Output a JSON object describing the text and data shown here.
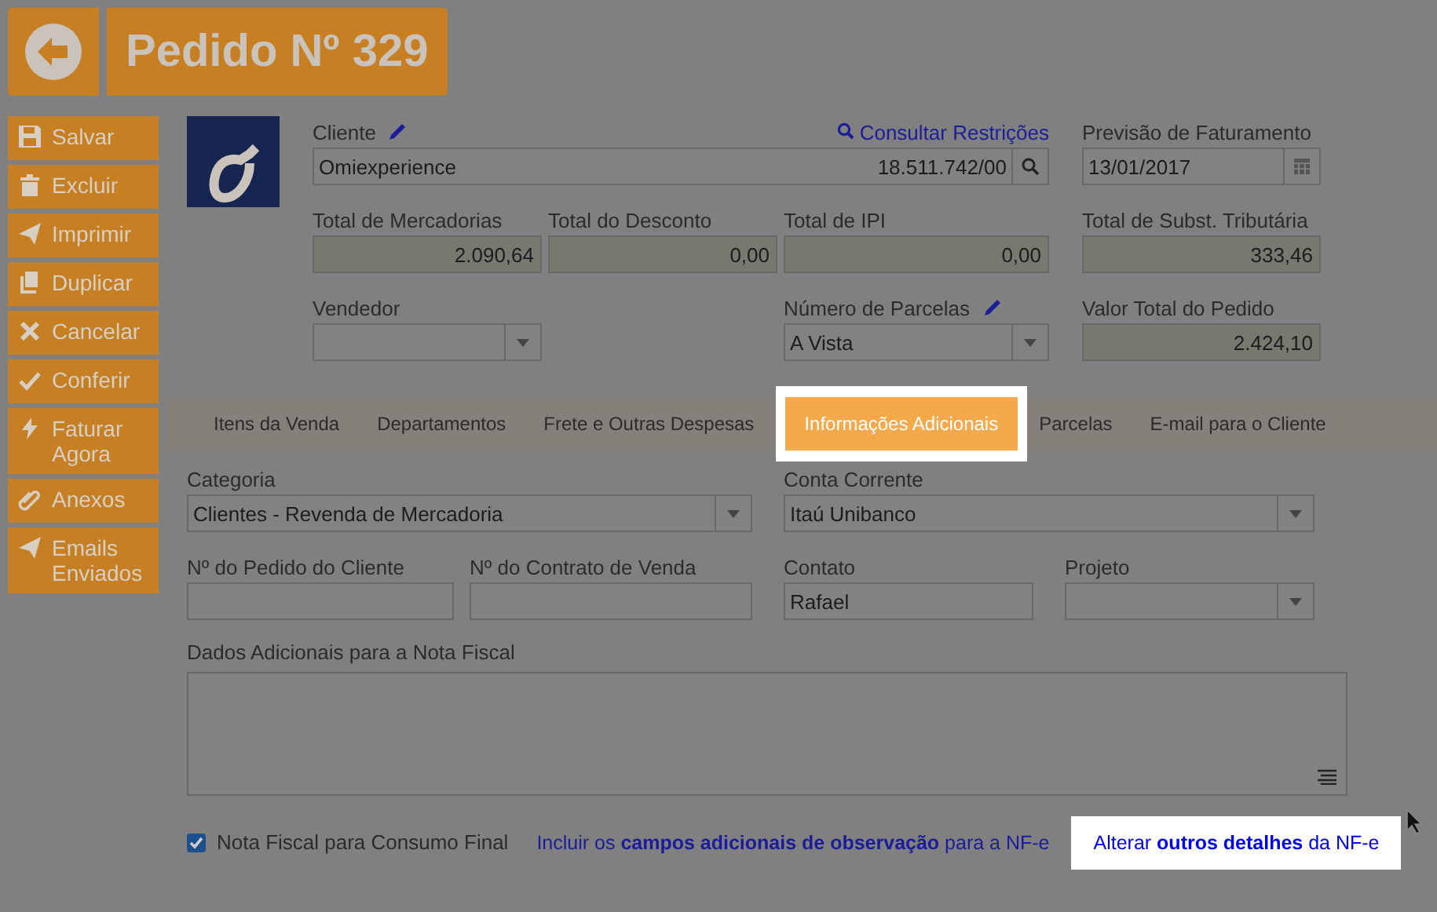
{
  "header": {
    "title": "Pedido Nº 329"
  },
  "sidebar": {
    "buttons": [
      {
        "kind": "save",
        "label": "Salvar"
      },
      {
        "kind": "delete",
        "label": "Excluir"
      },
      {
        "kind": "print",
        "label": "Imprimir"
      },
      {
        "kind": "duplicate",
        "label": "Duplicar"
      },
      {
        "kind": "cancel",
        "label": "Cancelar"
      },
      {
        "kind": "check",
        "label": "Conferir"
      },
      {
        "kind": "bolt",
        "label": "Faturar Agora"
      },
      {
        "kind": "attach",
        "label": "Anexos"
      },
      {
        "kind": "send",
        "label": "Emails Enviados"
      }
    ]
  },
  "order": {
    "client": {
      "label": "Cliente",
      "value": "Omiexperience",
      "document": "18.511.742/00",
      "link": "Consultar Restrições"
    },
    "billing_forecast": {
      "label": "Previsão de Faturamento",
      "value": "13/01/2017"
    },
    "totals": [
      {
        "label": "Total de Mercadorias",
        "value": "2.090,64"
      },
      {
        "label": "Total do Desconto",
        "value": "0,00"
      },
      {
        "label": "Total de IPI",
        "value": "0,00"
      },
      {
        "label": "Total de Subst. Tributária",
        "value": "333,46"
      }
    ],
    "seller": {
      "label": "Vendedor"
    },
    "installments": {
      "label": "Número de Parcelas",
      "value": "A Vista"
    },
    "order_total": {
      "label": "Valor Total do Pedido",
      "value": "2.424,10"
    }
  },
  "tabs": [
    {
      "label": "Itens da Venda",
      "selected": false
    },
    {
      "label": "Departamentos",
      "selected": false
    },
    {
      "label": "Frete e Outras Despesas",
      "selected": false
    },
    {
      "label": "Informações Adicionais",
      "selected": true
    },
    {
      "label": "Parcelas",
      "selected": false
    },
    {
      "label": "E-mail para o Cliente",
      "selected": false
    }
  ],
  "additional_info": {
    "fields": [
      {
        "kind": "select",
        "label": "Categoria",
        "value": "Clientes - Revenda de Mercadoria"
      },
      {
        "kind": "select",
        "label": "Conta Corrente",
        "value": "Itaú Unibanco"
      },
      {
        "kind": "text",
        "label": "Nº do Pedido do Cliente"
      },
      {
        "kind": "text",
        "label": "Nº do Contrato de Venda"
      },
      {
        "kind": "text",
        "label": "Contato",
        "value": "Rafael"
      },
      {
        "kind": "select",
        "label": "Projeto"
      }
    ],
    "notes": {
      "label": "Dados Adicionais para a Nota Fiscal"
    },
    "final_consumer": {
      "label": "Nota Fiscal para Consumo Final",
      "checked": true
    },
    "links": [
      {
        "text": "Incluir os **campos adicionais de observação** para a NF-e",
        "highlighted": false
      },
      {
        "text": "Alterar **outros detalhes** da NF-e",
        "highlighted": true
      }
    ]
  }
}
